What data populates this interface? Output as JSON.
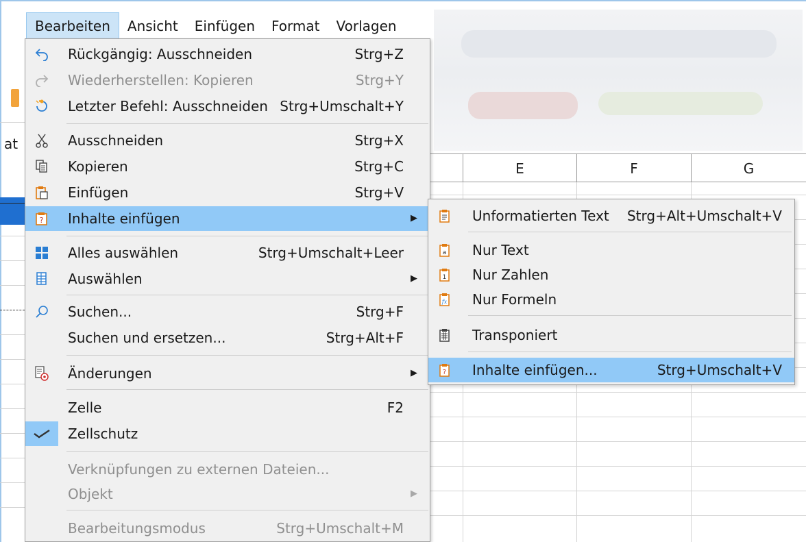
{
  "menubar": {
    "items": [
      "Bearbeiten",
      "Ansicht",
      "Einfügen",
      "Format",
      "Vorlagen"
    ]
  },
  "background": {
    "left_text": "at",
    "columns": [
      "E",
      "F",
      "G"
    ]
  },
  "edit_menu": {
    "undo": {
      "label": "Rückgängig: Ausschneiden",
      "shortcut": "Strg+Z"
    },
    "redo": {
      "label": "Wiederherstellen: Kopieren",
      "shortcut": "Strg+Y"
    },
    "repeat": {
      "label": "Letzter Befehl: Ausschneiden",
      "shortcut": "Strg+Umschalt+Y"
    },
    "cut": {
      "label": "Ausschneiden",
      "shortcut": "Strg+X"
    },
    "copy": {
      "label": "Kopieren",
      "shortcut": "Strg+C"
    },
    "paste": {
      "label": "Einfügen",
      "shortcut": "Strg+V"
    },
    "paste_special": {
      "label": "Inhalte einfügen"
    },
    "select_all": {
      "label": "Alles auswählen",
      "shortcut": "Strg+Umschalt+Leer"
    },
    "select": {
      "label": "Auswählen"
    },
    "find": {
      "label": "Suchen...",
      "shortcut": "Strg+F"
    },
    "find_replace": {
      "label": "Suchen und ersetzen...",
      "shortcut": "Strg+Alt+F"
    },
    "changes": {
      "label": "Änderungen"
    },
    "cell": {
      "label": "Zelle",
      "shortcut": "F2"
    },
    "cell_protect": {
      "label": "Zellschutz"
    },
    "links": {
      "label": "Verknüpfungen zu externen Dateien..."
    },
    "object": {
      "label": "Objekt"
    },
    "edit_mode": {
      "label": "Bearbeitungsmodus",
      "shortcut": "Strg+Umschalt+M"
    }
  },
  "paste_special_submenu": {
    "unformatted": {
      "label": "Unformatierten Text",
      "shortcut": "Strg+Alt+Umschalt+V"
    },
    "text_only": {
      "label": "Nur Text"
    },
    "numbers_only": {
      "label": "Nur Zahlen"
    },
    "formulas_only": {
      "label": "Nur Formeln"
    },
    "transposed": {
      "label": "Transponiert"
    },
    "paste_special_dialog": {
      "label": "Inhalte einfügen...",
      "shortcut": "Strg+Umschalt+V"
    }
  },
  "colors": {
    "highlight": "#91c9f7",
    "menu_bg": "#f0f0f0",
    "menubar_active": "#cce4f7"
  }
}
